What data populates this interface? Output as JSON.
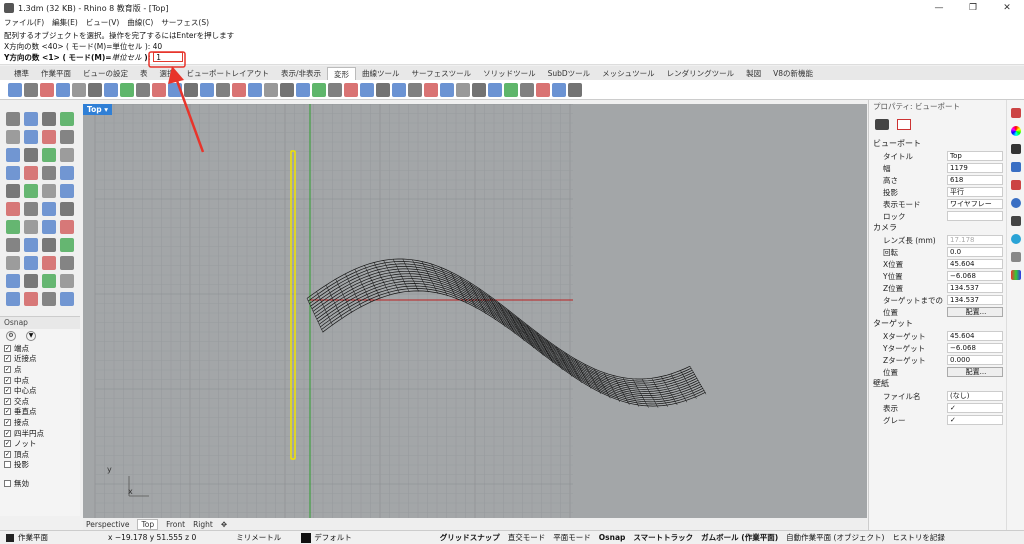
{
  "window": {
    "title": "1.3dm (32 KB) - Rhino 8 教育版 - [Top]",
    "minimize": "—",
    "maximize": "❐",
    "close": "✕"
  },
  "menu": [
    "ファイル(F)",
    "編集(E)",
    "ビュー(V)",
    "曲線(C)",
    "サーフェス(S)"
  ],
  "command": {
    "line1": "配列するオブジェクトを選択。操作を完了するにはEnterを押します",
    "line2": "X方向の数 <40> ( モード(M)=単位セル ): 40",
    "prompt_main": "Y方向の数 <1> ( モード(M)=",
    "prompt_italic": "単位セル",
    "prompt_end": " ):",
    "input_value": "1"
  },
  "tabs": [
    "標準",
    "作業平面",
    "ビューの設定",
    "表",
    "選択",
    "ビューポートレイアウト",
    "表示/非表示",
    "変形",
    "曲線ツール",
    "サーフェスツール",
    "ソリッドツール",
    "SubDツール",
    "メッシュツール",
    "レンダリングツール",
    "製図",
    "V8の新機能"
  ],
  "active_tab": "変形",
  "viewport": {
    "label": "Top ▾",
    "axis_y": "y",
    "axis_x": "x"
  },
  "viewport_tabs": [
    "Perspective",
    "Top",
    "Front",
    "Right",
    "✥"
  ],
  "osnap": {
    "header": "Osnap",
    "items": [
      {
        "label": "端点",
        "checked": true
      },
      {
        "label": "近接点",
        "checked": true
      },
      {
        "label": "点",
        "checked": true
      },
      {
        "label": "中点",
        "checked": true
      },
      {
        "label": "中心点",
        "checked": true
      },
      {
        "label": "交点",
        "checked": true
      },
      {
        "label": "垂直点",
        "checked": true
      },
      {
        "label": "接点",
        "checked": true
      },
      {
        "label": "四半円点",
        "checked": true
      },
      {
        "label": "ノット",
        "checked": true
      },
      {
        "label": "頂点",
        "checked": true
      },
      {
        "label": "投影",
        "checked": false
      }
    ],
    "disable": "無効"
  },
  "properties": {
    "header": "プロパティ: ビューポート",
    "viewport_section": "ビューポート",
    "camera_section": "カメラ",
    "target_section": "ターゲット",
    "wallpaper_section": "壁紙",
    "rows": {
      "title": {
        "k": "タイトル",
        "v": "Top"
      },
      "width": {
        "k": "幅",
        "v": "1179"
      },
      "height": {
        "k": "高さ",
        "v": "618"
      },
      "projection": {
        "k": "投影",
        "v": "平行"
      },
      "display_mode": {
        "k": "表示モード",
        "v": "ワイヤフレー"
      },
      "lock": {
        "k": "ロック",
        "v": ""
      },
      "lens": {
        "k": "レンズ長 (mm)",
        "v": "17.178"
      },
      "rotation": {
        "k": "回転",
        "v": "0.0"
      },
      "cam_x": {
        "k": "X位置",
        "v": "45.604"
      },
      "cam_y": {
        "k": "Y位置",
        "v": "−6.068"
      },
      "cam_z": {
        "k": "Z位置",
        "v": "134.537"
      },
      "target_dist": {
        "k": "ターゲットまでの",
        "v": "134.537"
      },
      "cam_place": {
        "k": "位置",
        "v": "配置..."
      },
      "tgt_x": {
        "k": "Xターゲット",
        "v": "45.604"
      },
      "tgt_y": {
        "k": "Yターゲット",
        "v": "−6.068"
      },
      "tgt_z": {
        "k": "Zターゲット",
        "v": "0.000"
      },
      "tgt_place": {
        "k": "位置",
        "v": "配置..."
      },
      "file": {
        "k": "ファイル名",
        "v": "(なし)"
      },
      "show": {
        "k": "表示",
        "v": "✓"
      },
      "gray": {
        "k": "グレー",
        "v": "✓"
      }
    }
  },
  "status": {
    "plane": "作業平面",
    "coords": "x −19.178  y 51.555  z 0",
    "units": "ミリメートル",
    "layer": "デフォルト",
    "grid_snap": "グリッドスナップ",
    "ortho": "直交モード",
    "planar": "平面モード",
    "osnap": "Osnap",
    "smart_track": "スマートトラック",
    "gumball": "ガムボール (作業平面)",
    "auto_cplane": "自動作業平面 (オブジェクト)",
    "history": "ヒストリを記録"
  },
  "colors": {
    "accent": "#2f7fd6",
    "highlight": "#e8342b",
    "viewport_bg": "#a3a6a8"
  }
}
